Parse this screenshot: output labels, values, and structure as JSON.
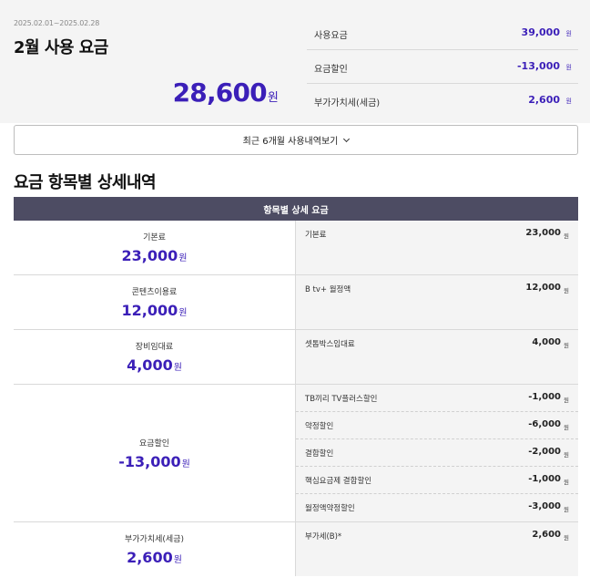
{
  "summary": {
    "period": "2025.02.01~2025.02.28",
    "title": "2월 사용 요금",
    "total_amount": "28,600",
    "total_unit": "원",
    "breakdown": [
      {
        "label": "사용요금",
        "value": "39,000",
        "unit": "원"
      },
      {
        "label": "요금할인",
        "value": "-13,000",
        "unit": "원"
      },
      {
        "label": "부가가치세(세금)",
        "value": "2,600",
        "unit": "원"
      }
    ]
  },
  "history_button": {
    "label": "최근 6개월 사용내역보기"
  },
  "section_title": "요금 항목별 상세내역",
  "detail_table": {
    "header": "항목별 상세 요금",
    "groups": [
      {
        "label": "기본료",
        "amount": "23,000",
        "unit": "원",
        "items": [
          {
            "label": "기본료",
            "value": "23,000",
            "unit": "원"
          }
        ]
      },
      {
        "label": "콘텐츠이용료",
        "amount": "12,000",
        "unit": "원",
        "items": [
          {
            "label": "B tv+ 월정액",
            "value": "12,000",
            "unit": "원"
          }
        ]
      },
      {
        "label": "장비임대료",
        "amount": "4,000",
        "unit": "원",
        "items": [
          {
            "label": "셋톱박스임대료",
            "value": "4,000",
            "unit": "원"
          }
        ]
      },
      {
        "label": "요금할인",
        "amount": "-13,000",
        "unit": "원",
        "items": [
          {
            "label": "TB끼리 TV플러스할인",
            "value": "-1,000",
            "unit": "원"
          },
          {
            "label": "약정할인",
            "value": "-6,000",
            "unit": "원"
          },
          {
            "label": "결합할인",
            "value": "-2,000",
            "unit": "원"
          },
          {
            "label": "핵심요금제 결합할인",
            "value": "-1,000",
            "unit": "원"
          },
          {
            "label": "월정액약정할인",
            "value": "-3,000",
            "unit": "원"
          }
        ]
      },
      {
        "label": "부가가치세(세금)",
        "amount": "2,600",
        "unit": "원",
        "items": [
          {
            "label": "부가세(B)*",
            "value": "2,600",
            "unit": "원"
          }
        ]
      }
    ]
  },
  "colors": {
    "accent": "#3b1fb8",
    "header_bg": "#4d4c63",
    "summary_bg": "#f4f4f4"
  },
  "icons": {
    "history_button": "chevron-down-icon"
  }
}
